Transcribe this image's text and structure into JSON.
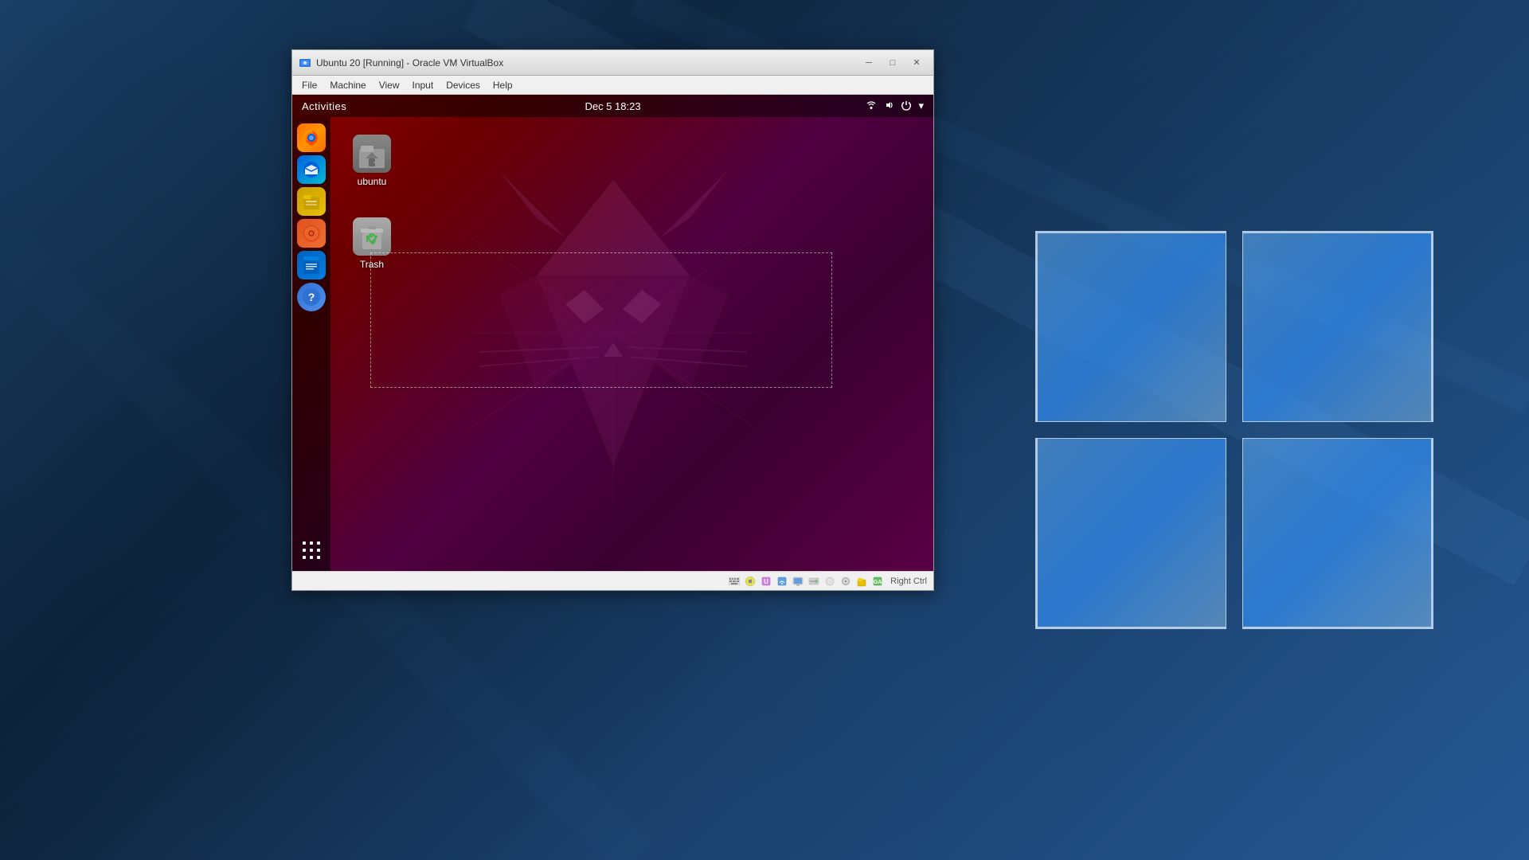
{
  "windows": {
    "bg_colors": [
      "#1a3a5c",
      "#0d2137",
      "#2a6aaa"
    ],
    "logo": {
      "pane_color": "rgba(100,180,255,0.7)"
    }
  },
  "vbox": {
    "title": "Ubuntu 20 [Running] - Oracle VM VirtualBox",
    "icon": "vbox-icon",
    "controls": {
      "minimize": "─",
      "maximize": "□",
      "close": "✕"
    },
    "menu": {
      "items": [
        "File",
        "Machine",
        "View",
        "Input",
        "Devices",
        "Help"
      ]
    },
    "statusbar": {
      "right_ctrl_label": "Right Ctrl"
    }
  },
  "ubuntu": {
    "topbar": {
      "activities": "Activities",
      "clock": "Dec 5  18:23",
      "icons": [
        "network",
        "sound",
        "power",
        "arrow"
      ]
    },
    "sidebar": {
      "apps": [
        {
          "name": "Firefox",
          "id": "firefox"
        },
        {
          "name": "Thunderbird",
          "id": "thunderbird"
        },
        {
          "name": "Files",
          "id": "files"
        },
        {
          "name": "Rhythmbox",
          "id": "rhythmbox"
        },
        {
          "name": "Writer",
          "id": "writer"
        },
        {
          "name": "Help",
          "id": "help"
        }
      ],
      "grid_label": "Show Applications"
    },
    "desktop": {
      "icons": [
        {
          "id": "home",
          "label": "ubuntu",
          "type": "home"
        },
        {
          "id": "trash",
          "label": "Trash",
          "type": "trash"
        }
      ]
    }
  }
}
